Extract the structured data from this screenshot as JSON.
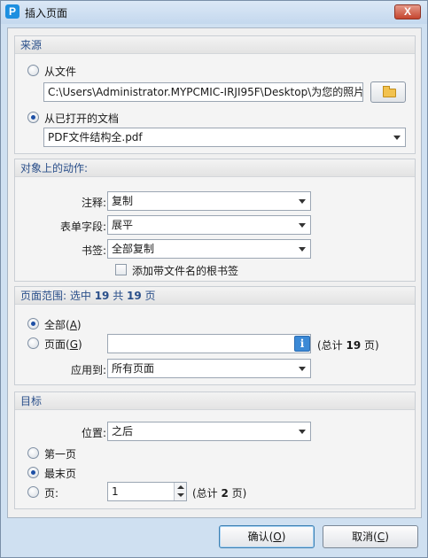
{
  "window": {
    "title": "插入页面",
    "app_icon": "P",
    "close_glyph": "X"
  },
  "source": {
    "header": "来源",
    "from_file_label": "从文件",
    "file_path": "C:\\Users\\Administrator.MYPCMIC-IRJI95F\\Desktop\\为您的照片",
    "from_open_doc_label": "从已打开的文档",
    "open_doc_selected": "PDF文件结构全.pdf",
    "selected_option": "从已打开的文档"
  },
  "actions": {
    "header": "对象上的动作:",
    "comments_label": "注释:",
    "comments_value": "复制",
    "form_fields_label": "表单字段:",
    "form_fields_value": "展平",
    "bookmarks_label": "书签:",
    "bookmarks_value": "全部复制",
    "add_bookmark_label": "添加带文件名的根书签",
    "add_bookmark_checked": false
  },
  "range": {
    "header_prefix": "页面范围: 选中 ",
    "selected_count": "19",
    "header_mid": " 共 ",
    "total_count": "19",
    "header_suffix": " 页",
    "all_label_prefix": "全部(",
    "all_key": "A",
    "pages_label_prefix": "页面(",
    "pages_key": "G",
    "label_suffix": ")",
    "pages_value": "",
    "total_prefix": "(总计 ",
    "total_pages": "19",
    "total_suffix": " 页)",
    "apply_to_label": "应用到:",
    "apply_to_value": "所有页面",
    "selected_option": "全部"
  },
  "target": {
    "header": "目标",
    "position_label": "位置:",
    "position_value": "之后",
    "first_page_label": "第一页",
    "last_page_label": "最末页",
    "page_label": "页:",
    "page_value": "1",
    "total_prefix": "(总计 ",
    "total_pages": "2",
    "total_suffix": " 页)",
    "selected_option": "最末页"
  },
  "buttons": {
    "ok_prefix": "确认(",
    "ok_key": "O",
    "cancel_prefix": "取消(",
    "cancel_key": "C",
    "suffix": ")"
  },
  "colors": {
    "accent": "#1d4fa5",
    "group_header_text": "#2a4f8a",
    "window_frame": "#cfe0f1"
  }
}
